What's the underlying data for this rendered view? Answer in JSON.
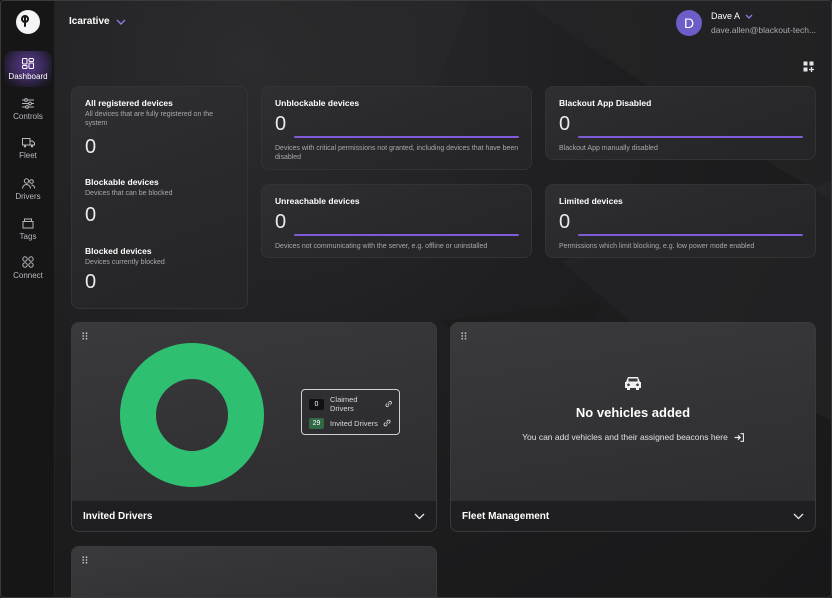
{
  "sidebar": {
    "logo_icon": "blackout-logo",
    "items": [
      {
        "label": "Dashboard",
        "icon": "dashboard-icon",
        "active": true
      },
      {
        "label": "Controls",
        "icon": "sliders-icon",
        "active": false
      },
      {
        "label": "Fleet",
        "icon": "truck-icon",
        "active": false
      },
      {
        "label": "Drivers",
        "icon": "users-icon",
        "active": false
      },
      {
        "label": "Tags",
        "icon": "tag-icon",
        "active": false
      },
      {
        "label": "Connect",
        "icon": "connect-icon",
        "active": false
      }
    ]
  },
  "header": {
    "org_name": "Icarative",
    "user": {
      "initial": "D",
      "name": "Dave A",
      "email": "dave.allen@blackout-tech..."
    },
    "add_widget_icon": "add-widget-icon"
  },
  "summary_card": {
    "sections": [
      {
        "title": "All registered devices",
        "subtitle": "All devices that are fully registered on the system",
        "value": "0"
      },
      {
        "title": "Blockable devices",
        "subtitle": "Devices that can be blocked",
        "value": "0"
      },
      {
        "title": "Blocked devices",
        "subtitle": "Devices currently blocked",
        "value": "0"
      }
    ]
  },
  "metric_cards": [
    {
      "title": "Unblockable devices",
      "value": "0",
      "description": "Devices with critical permissions not granted, including devices that have been disabled"
    },
    {
      "title": "Blackout App Disabled",
      "value": "0",
      "description": "Blackout App manually disabled"
    },
    {
      "title": "Unreachable devices",
      "value": "0",
      "description": "Devices not communicating with the server, e.g. offline or uninstalled"
    },
    {
      "title": "Limited devices",
      "value": "0",
      "description": "Permissions which limit blocking, e.g. low power mode enabled"
    }
  ],
  "invited_drivers_panel": {
    "title": "Invited Drivers",
    "legend": [
      {
        "count": "0",
        "label": "Claimed Drivers",
        "color": "#111113"
      },
      {
        "count": "29",
        "label": "Invited Drivers",
        "color": "#2f6a45"
      }
    ],
    "chart_data": {
      "type": "pie",
      "categories": [
        "Claimed Drivers",
        "Invited Drivers"
      ],
      "values": [
        0,
        29
      ],
      "colors": [
        "#111113",
        "#2fbf71"
      ]
    }
  },
  "fleet_panel": {
    "title": "Fleet Management",
    "empty_title": "No vehicles added",
    "empty_subtitle": "You can add vehicles and their assigned beacons here"
  },
  "colors": {
    "accent": "#7f5bd6",
    "donut_green": "#2fbf71",
    "avatar": "#6b5ec7"
  }
}
